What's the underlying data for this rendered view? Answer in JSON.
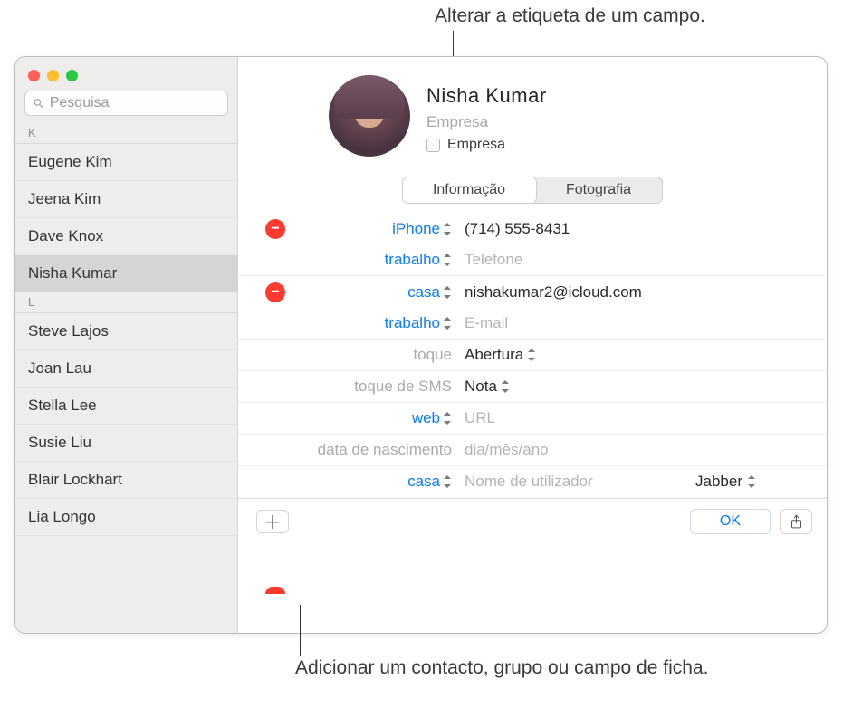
{
  "callouts": {
    "top": "Alterar a etiqueta de um campo.",
    "bottom": "Adicionar um contacto, grupo ou campo de ficha."
  },
  "search": {
    "placeholder": "Pesquisa"
  },
  "sections": {
    "k": {
      "header": "K",
      "items": [
        "Eugene Kim",
        "Jeena Kim",
        "Dave Knox",
        "Nisha Kumar"
      ],
      "selected_index": 3
    },
    "l": {
      "header": "L",
      "items": [
        "Steve Lajos",
        "Joan Lau",
        "Stella Lee",
        "Susie Liu",
        "Blair Lockhart",
        "Lia Longo"
      ]
    }
  },
  "contact": {
    "name": "Nisha  Kumar",
    "company_placeholder": "Empresa",
    "company_checkbox_label": "Empresa"
  },
  "tabs": {
    "info": "Informação",
    "photo": "Fotografia"
  },
  "fields": {
    "phone_iphone": {
      "label": "iPhone",
      "value": "(714) 555-8431"
    },
    "phone_work": {
      "label": "trabalho",
      "placeholder": "Telefone"
    },
    "email_home": {
      "label": "casa",
      "value": "nishakumar2@icloud.com"
    },
    "email_work": {
      "label": "trabalho",
      "placeholder": "E-mail"
    },
    "ringtone": {
      "label": "toque",
      "value": "Abertura"
    },
    "texttone": {
      "label": "toque de SMS",
      "value": "Nota"
    },
    "web": {
      "label": "web",
      "placeholder": "URL"
    },
    "birthday": {
      "label": "data de nascimento",
      "placeholder": "dia/mês/ano"
    },
    "im": {
      "label": "casa",
      "placeholder": "Nome de utilizador",
      "service": "Jabber"
    }
  },
  "footer": {
    "ok": "OK"
  }
}
